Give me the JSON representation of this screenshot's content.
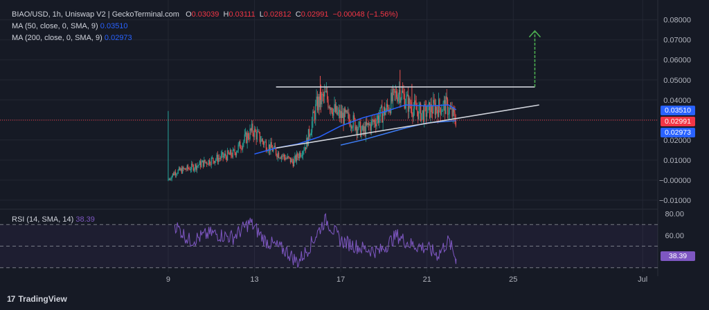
{
  "header": {
    "symbol": "BIAO/USD, 1h, Uniswap V2 | GeckoTerminal.com",
    "o_label": "O",
    "o": "0.03039",
    "h_label": "H",
    "h": "0.03111",
    "l_label": "L",
    "l": "0.02812",
    "c_label": "C",
    "c": "0.02991",
    "change": "−0.00048 (−1.56%)"
  },
  "ma50": {
    "label": "MA (50, close, 0, SMA, 9)",
    "value": "0.03510"
  },
  "ma200": {
    "label": "MA (200, close, 0, SMA, 9)",
    "value": "0.02973"
  },
  "rsi": {
    "label": "RSI (14, SMA, 14)",
    "value": "38.39"
  },
  "price_tags": {
    "ma50": "0.03510",
    "close": "0.02991",
    "ma200": "0.02973"
  },
  "brand": {
    "logo": "17",
    "name": "TradingView"
  },
  "colors": {
    "up": "#26a69a",
    "down": "#ef5350",
    "ma50": "#2962ff",
    "rsi": "#7e57c2",
    "background": "#161a25"
  },
  "chart_data": [
    {
      "type": "candlestick",
      "title": "BIAO/USD, 1h, Uniswap V2 | GeckoTerminal.com",
      "y_ticks": [
        "0.08000",
        "0.07000",
        "0.06000",
        "0.05000",
        "0.04000",
        "0.03000",
        "0.02000",
        "0.01000",
        "−0.00000",
        "−0.01000"
      ],
      "x_ticks": [
        "9",
        "13",
        "17",
        "21",
        "25",
        "Jul"
      ],
      "ylim": [
        -0.0135,
        0.083
      ],
      "x_tick_days": [
        9,
        13,
        17,
        21,
        25,
        31
      ],
      "xlim_days": [
        1.2,
        31.7
      ],
      "data_start_day": 9.0,
      "data_end_day": 22.35,
      "ohlc_keypoints": [
        [
          9.0,
          0.0
        ],
        [
          9.3,
          0.004
        ],
        [
          10.0,
          0.006
        ],
        [
          11.0,
          0.01
        ],
        [
          12.0,
          0.013
        ],
        [
          12.9,
          0.025
        ],
        [
          13.4,
          0.019
        ],
        [
          14.0,
          0.014
        ],
        [
          14.8,
          0.009
        ],
        [
          15.4,
          0.018
        ],
        [
          15.9,
          0.038
        ],
        [
          16.3,
          0.042
        ],
        [
          16.8,
          0.033
        ],
        [
          17.5,
          0.03
        ],
        [
          18.0,
          0.024
        ],
        [
          18.6,
          0.03
        ],
        [
          19.1,
          0.035
        ],
        [
          19.7,
          0.045
        ],
        [
          20.2,
          0.037
        ],
        [
          20.8,
          0.033
        ],
        [
          21.3,
          0.036
        ],
        [
          21.9,
          0.037
        ],
        [
          22.35,
          0.03
        ]
      ],
      "series": [
        {
          "name": "MA (50, close, 0, SMA, 9)",
          "points": [
            [
              13.0,
              0.013
            ],
            [
              14.0,
              0.016
            ],
            [
              15.0,
              0.018
            ],
            [
              16.0,
              0.0215
            ],
            [
              17.0,
              0.027
            ],
            [
              18.0,
              0.031
            ],
            [
              19.0,
              0.034
            ],
            [
              20.0,
              0.0375
            ],
            [
              21.0,
              0.037
            ],
            [
              22.0,
              0.0375
            ],
            [
              22.35,
              0.0351
            ]
          ]
        },
        {
          "name": "MA (200, close, 0, SMA, 9)",
          "points": [
            [
              17.0,
              0.0175
            ],
            [
              18.0,
              0.02
            ],
            [
              19.0,
              0.023
            ],
            [
              20.0,
              0.026
            ],
            [
              21.0,
              0.0285
            ],
            [
              22.35,
              0.0297
            ]
          ]
        }
      ],
      "close": 0.02991,
      "annotations": {
        "resistance": {
          "from_day": 14.0,
          "to_day": 26.0,
          "y": 0.0465
        },
        "ascending_trendline": {
          "from": [
            14.0,
            0.016
          ],
          "to": [
            26.2,
            0.0375
          ]
        },
        "target_arrow": {
          "day": 26.0,
          "from": 0.0465,
          "to": 0.0745
        }
      }
    },
    {
      "type": "line",
      "title": "RSI (14, SMA, 14)",
      "y_ticks": [
        "80.00",
        "60.00"
      ],
      "ylim": [
        26,
        83
      ],
      "levels": [
        70,
        50,
        30
      ],
      "keypoints": [
        [
          9.3,
          70
        ],
        [
          10.0,
          55
        ],
        [
          11.0,
          62
        ],
        [
          12.0,
          58
        ],
        [
          12.8,
          72
        ],
        [
          13.5,
          55
        ],
        [
          14.5,
          45
        ],
        [
          15.0,
          35
        ],
        [
          15.5,
          48
        ],
        [
          16.0,
          65
        ],
        [
          16.3,
          75
        ],
        [
          17.0,
          55
        ],
        [
          18.0,
          48
        ],
        [
          18.8,
          45
        ],
        [
          19.6,
          60
        ],
        [
          20.2,
          52
        ],
        [
          21.0,
          48
        ],
        [
          21.5,
          42
        ],
        [
          22.0,
          55
        ],
        [
          22.35,
          38.39
        ]
      ],
      "value": "38.39"
    }
  ]
}
